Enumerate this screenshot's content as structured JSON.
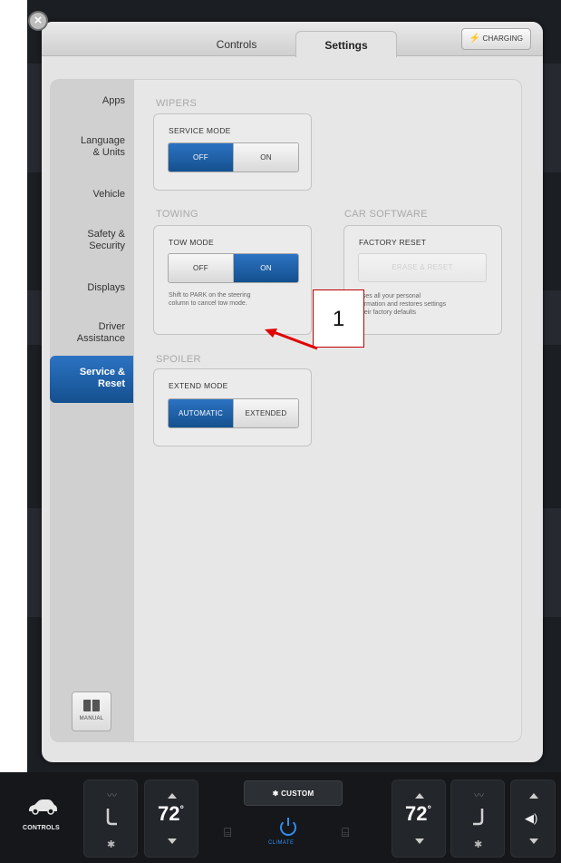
{
  "tabs": {
    "controls": "Controls",
    "settings": "Settings"
  },
  "charging_label": "CHARGING",
  "sidebar": {
    "items": [
      {
        "l1": "Apps",
        "l2": ""
      },
      {
        "l1": "Language",
        "l2": "& Units"
      },
      {
        "l1": "Vehicle",
        "l2": ""
      },
      {
        "l1": "Safety &",
        "l2": "Security"
      },
      {
        "l1": "Displays",
        "l2": ""
      },
      {
        "l1": "Driver",
        "l2": "Assistance"
      },
      {
        "l1": "Service &",
        "l2": "Reset"
      }
    ],
    "selected": "Service & Reset",
    "manual_label": "MANUAL"
  },
  "wipers": {
    "section": "WIPERS",
    "card_title": "SERVICE MODE",
    "options": [
      "OFF",
      "ON"
    ],
    "selected": "OFF"
  },
  "towing": {
    "section": "TOWING",
    "card_title": "TOW MODE",
    "options": [
      "OFF",
      "ON"
    ],
    "selected": "ON",
    "note_l1": "Shift to PARK on the steering",
    "note_l2": "column to cancel tow mode."
  },
  "software": {
    "section": "CAR SOFTWARE",
    "card_title": "FACTORY RESET",
    "button": "ERASE & RESET",
    "note_l1": "ases all your personal",
    "note_l2": "formation and restores settings",
    "note_l3": "their factory defaults"
  },
  "spoiler": {
    "section": "SPOILER",
    "card_title": "EXTEND MODE",
    "options": [
      "AUTOMATIC",
      "EXTENDED"
    ],
    "selected": "AUTOMATIC"
  },
  "callout": {
    "number": "1",
    "color": "#c00000"
  },
  "climate": {
    "controls_label": "CONTROLS",
    "left_temp": "72",
    "right_temp": "72",
    "degree": "°",
    "custom_label": "CUSTOM",
    "climate_label": "CLIMATE",
    "accent": "#2f8ef0"
  },
  "colors": {
    "selected_blue": "#1a5ea8",
    "panel_bg": "#e4e4e4"
  }
}
